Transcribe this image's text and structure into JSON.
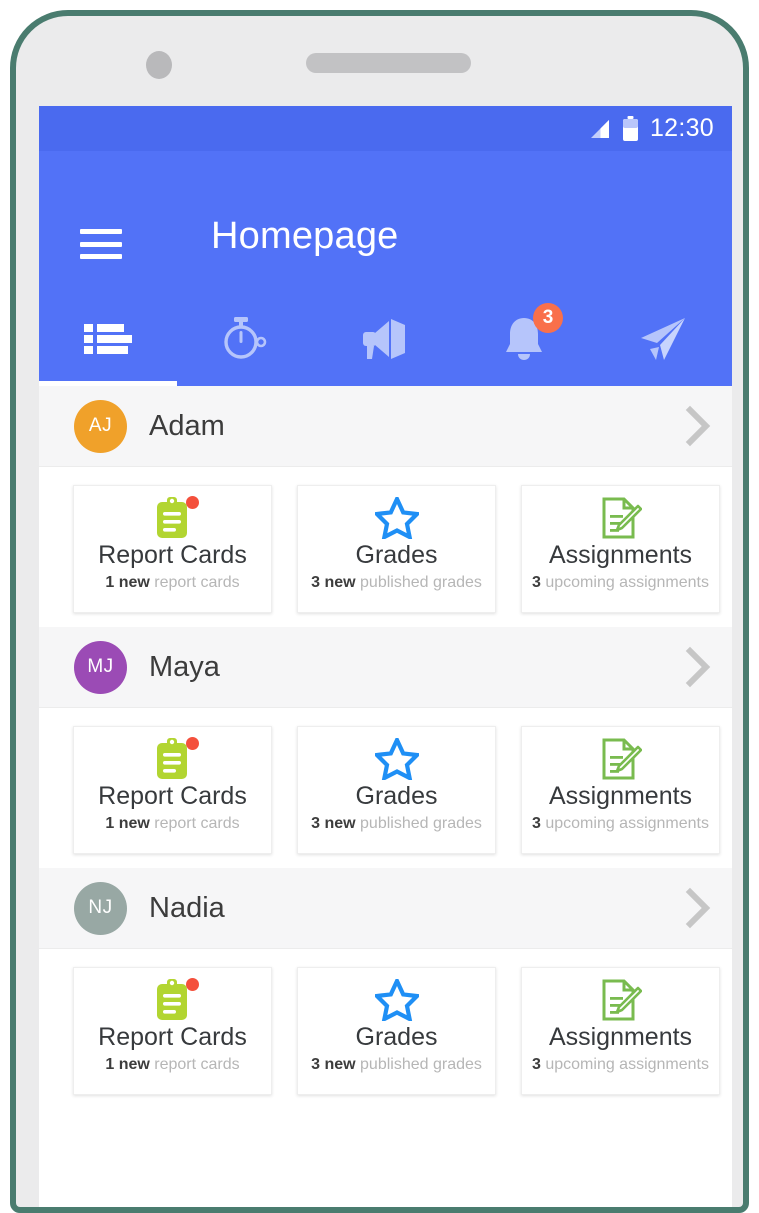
{
  "device": {
    "frame_color": "#4a7c6f",
    "body_color": "#ebebec",
    "camera_icon": "camera-dot",
    "speaker_icon": "speaker-grille"
  },
  "status_bar": {
    "time": "12:30",
    "signal_icon": "signal-bars-icon",
    "battery_icon": "battery-icon",
    "background": "#4a6aef"
  },
  "app_bar": {
    "title": "Homepage",
    "menu_icon": "hamburger-menu-icon",
    "background": "#5272f7"
  },
  "tabs": [
    {
      "name": "list",
      "icon": "list-icon",
      "active": true,
      "badge": ""
    },
    {
      "name": "timer",
      "icon": "stopwatch-icon",
      "active": false,
      "badge": ""
    },
    {
      "name": "announcements",
      "icon": "megaphone-icon",
      "active": false,
      "badge": ""
    },
    {
      "name": "notifications",
      "icon": "bell-icon",
      "active": false,
      "badge": "3"
    },
    {
      "name": "messages",
      "icon": "send-paper-plane-icon",
      "active": false,
      "badge": ""
    }
  ],
  "tab_badge_color": "#f9704b",
  "students": [
    {
      "name": "Adam",
      "initials": "AJ",
      "avatar_color": "#f0a12a",
      "chevron_icon": "chevron-right-icon",
      "tiles": [
        {
          "title": "Report Cards",
          "icon": "clipboard-icon",
          "icon_color": "#b2d531",
          "has_dot": true,
          "count": "1",
          "count_label": "new",
          "sub_rest": "report cards"
        },
        {
          "title": "Grades",
          "icon": "star-outline-icon",
          "icon_color": "#1f8ff5",
          "has_dot": false,
          "count": "3",
          "count_label": "new",
          "sub_rest": "published grades"
        },
        {
          "title": "Assignments",
          "icon": "document-pencil-icon",
          "icon_color": "#79bb4f",
          "has_dot": false,
          "count": "3",
          "count_label": "",
          "sub_rest": "upcoming assignments"
        },
        {
          "title": "",
          "icon": "",
          "icon_color": "",
          "has_dot": false,
          "count": "",
          "count_label": "",
          "sub_rest": ""
        }
      ]
    },
    {
      "name": "Maya",
      "initials": "MJ",
      "avatar_color": "#9b4bb5",
      "chevron_icon": "chevron-right-icon",
      "tiles": [
        {
          "title": "Report Cards",
          "icon": "clipboard-icon",
          "icon_color": "#b2d531",
          "has_dot": true,
          "count": "1",
          "count_label": "new",
          "sub_rest": "report cards"
        },
        {
          "title": "Grades",
          "icon": "star-outline-icon",
          "icon_color": "#1f8ff5",
          "has_dot": false,
          "count": "3",
          "count_label": "new",
          "sub_rest": "published grades"
        },
        {
          "title": "Assignments",
          "icon": "document-pencil-icon",
          "icon_color": "#79bb4f",
          "has_dot": false,
          "count": "3",
          "count_label": "",
          "sub_rest": "upcoming assignments"
        },
        {
          "title": "",
          "icon": "",
          "icon_color": "",
          "has_dot": false,
          "count": "",
          "count_label": "",
          "sub_rest": ""
        }
      ]
    },
    {
      "name": "Nadia",
      "initials": "NJ",
      "avatar_color": "#98a8a4",
      "chevron_icon": "chevron-right-icon",
      "tiles": [
        {
          "title": "Report Cards",
          "icon": "clipboard-icon",
          "icon_color": "#b2d531",
          "has_dot": true,
          "count": "1",
          "count_label": "new",
          "sub_rest": "report cards"
        },
        {
          "title": "Grades",
          "icon": "star-outline-icon",
          "icon_color": "#1f8ff5",
          "has_dot": false,
          "count": "3",
          "count_label": "new",
          "sub_rest": "published grades"
        },
        {
          "title": "Assignments",
          "icon": "document-pencil-icon",
          "icon_color": "#79bb4f",
          "has_dot": false,
          "count": "3",
          "count_label": "",
          "sub_rest": "upcoming assignments"
        },
        {
          "title": "",
          "icon": "",
          "icon_color": "",
          "has_dot": false,
          "count": "",
          "count_label": "",
          "sub_rest": ""
        }
      ]
    }
  ]
}
